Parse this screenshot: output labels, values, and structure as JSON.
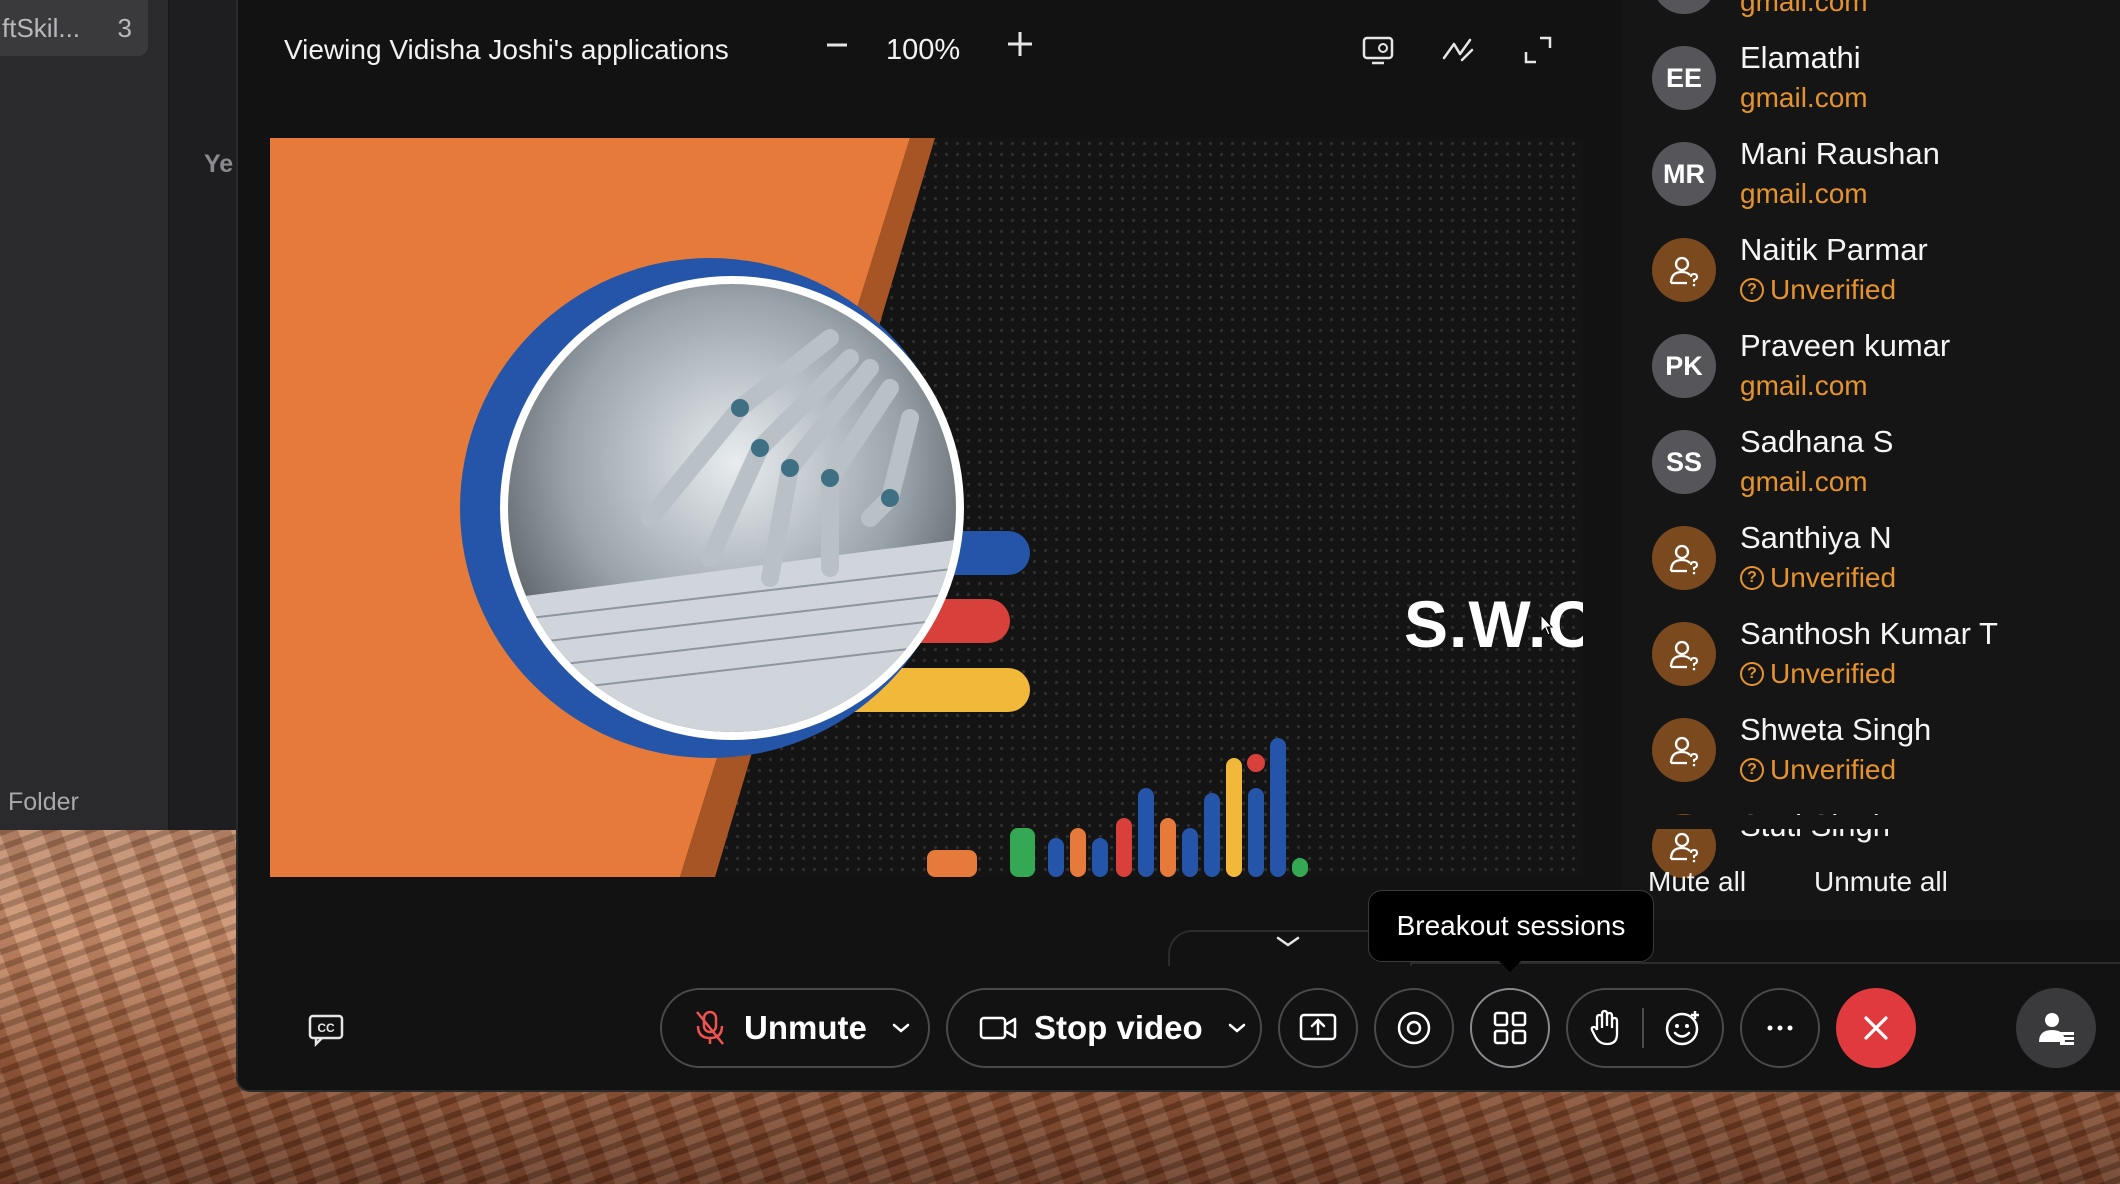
{
  "background_window": {
    "chip_label": "ftSkil...",
    "chip_count": "3",
    "partial_text": "Ye",
    "folder_label": "Folder"
  },
  "topbar": {
    "title": "Viewing Vidisha Joshi's applications",
    "zoom_out_icon": "minus-icon",
    "zoom_level": "100%",
    "zoom_in_icon": "plus-icon",
    "tools": [
      "screen-share-options-icon",
      "annotate-icon",
      "fullscreen-icon"
    ]
  },
  "slide": {
    "title": "S.W.O.T",
    "colors": {
      "orange": "#e67a3a",
      "blue": "#2455a8",
      "red": "#d8413b",
      "yellow": "#f2b83a",
      "dark": "#141414"
    }
  },
  "participants": [
    {
      "initials": "",
      "name": "",
      "sub": "gmail.com",
      "type": "email"
    },
    {
      "initials": "EE",
      "name": "Elamathi",
      "sub": "gmail.com",
      "type": "email"
    },
    {
      "initials": "MR",
      "name": "Mani Raushan",
      "sub": "gmail.com",
      "type": "email"
    },
    {
      "initials": "",
      "name": "Naitik Parmar",
      "sub": "Unverified",
      "type": "guest"
    },
    {
      "initials": "PK",
      "name": "Praveen kumar",
      "sub": "gmail.com",
      "type": "email"
    },
    {
      "initials": "SS",
      "name": "Sadhana S",
      "sub": "gmail.com",
      "type": "email"
    },
    {
      "initials": "",
      "name": "Santhiya N",
      "sub": "Unverified",
      "type": "guest"
    },
    {
      "initials": "",
      "name": "Santhosh Kumar T",
      "sub": "Unverified",
      "type": "guest"
    },
    {
      "initials": "",
      "name": "Shweta Singh",
      "sub": "Unverified",
      "type": "guest"
    },
    {
      "initials": "",
      "name": "Stuti Singh",
      "sub": "",
      "type": "guest"
    }
  ],
  "panel_actions": {
    "mute_all": "Mute all",
    "unmute_all": "Unmute all"
  },
  "tooltip": "Breakout sessions",
  "controls": {
    "unmute": "Unmute",
    "stop_video": "Stop video"
  },
  "colors": {
    "accent_orange": "#e6932e",
    "end_red": "#e03a3e",
    "panel_bg": "#151515"
  }
}
